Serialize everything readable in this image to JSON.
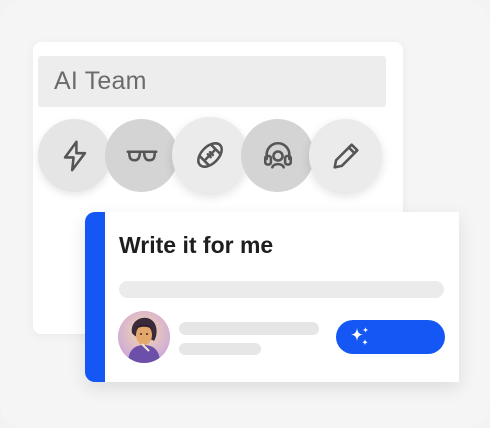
{
  "team_panel": {
    "title": "AI Team",
    "icons": [
      {
        "name": "lightning-icon"
      },
      {
        "name": "glasses-icon"
      },
      {
        "name": "football-icon"
      },
      {
        "name": "headset-icon"
      },
      {
        "name": "pencil-icon"
      }
    ]
  },
  "write_card": {
    "title": "Write it for me",
    "action_icon": "sparkle-icon"
  },
  "colors": {
    "accent": "#1457f5",
    "panel_bg": "#ffffff",
    "skeleton": "#ebebeb"
  }
}
